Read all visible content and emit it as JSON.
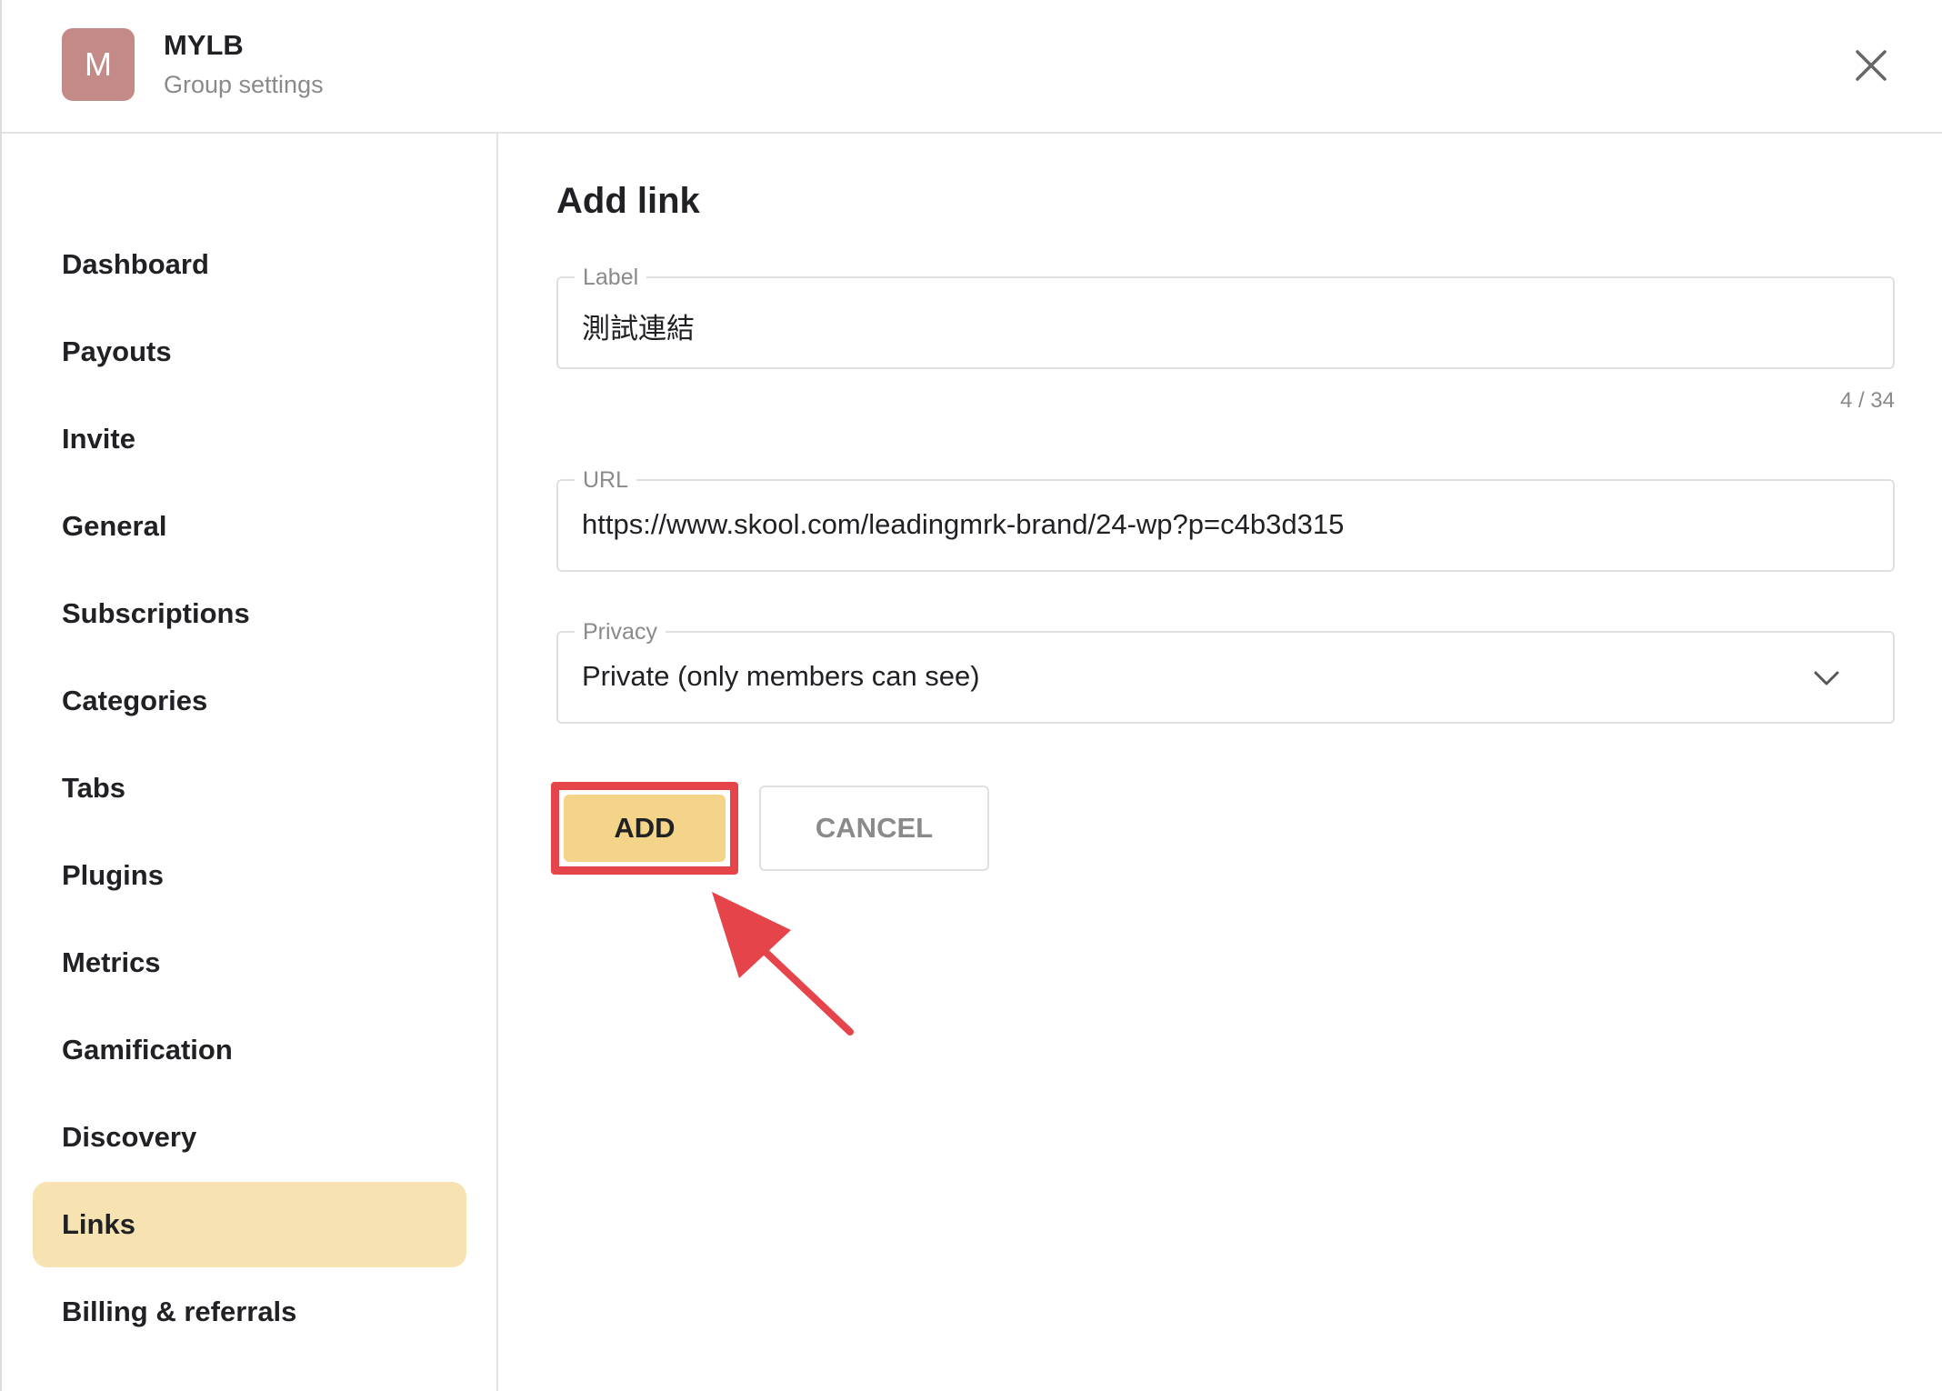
{
  "header": {
    "avatar_letter": "M",
    "group_name": "MYLB",
    "subtitle": "Group settings",
    "close_icon": "close-icon"
  },
  "sidebar": {
    "items": [
      {
        "label": "Dashboard"
      },
      {
        "label": "Payouts"
      },
      {
        "label": "Invite"
      },
      {
        "label": "General"
      },
      {
        "label": "Subscriptions"
      },
      {
        "label": "Categories"
      },
      {
        "label": "Tabs"
      },
      {
        "label": "Plugins"
      },
      {
        "label": "Metrics"
      },
      {
        "label": "Gamification"
      },
      {
        "label": "Discovery"
      },
      {
        "label": "Links",
        "active": true
      },
      {
        "label": "Billing & referrals"
      }
    ]
  },
  "main": {
    "title": "Add link",
    "label_field": {
      "label": "Label",
      "value": "測試連結",
      "counter": "4 / 34"
    },
    "url_field": {
      "label": "URL",
      "value": "https://www.skool.com/leadingmrk-brand/24-wp?p=c4b3d315"
    },
    "privacy_field": {
      "label": "Privacy",
      "value": "Private (only members can see)",
      "icon": "chevron-down-icon"
    },
    "add_button": "ADD",
    "cancel_button": "CANCEL"
  },
  "colors": {
    "accent": "#f4d488",
    "active_nav": "#f7e3b1",
    "avatar": "#c48a88",
    "annotation": "#e5444a"
  }
}
